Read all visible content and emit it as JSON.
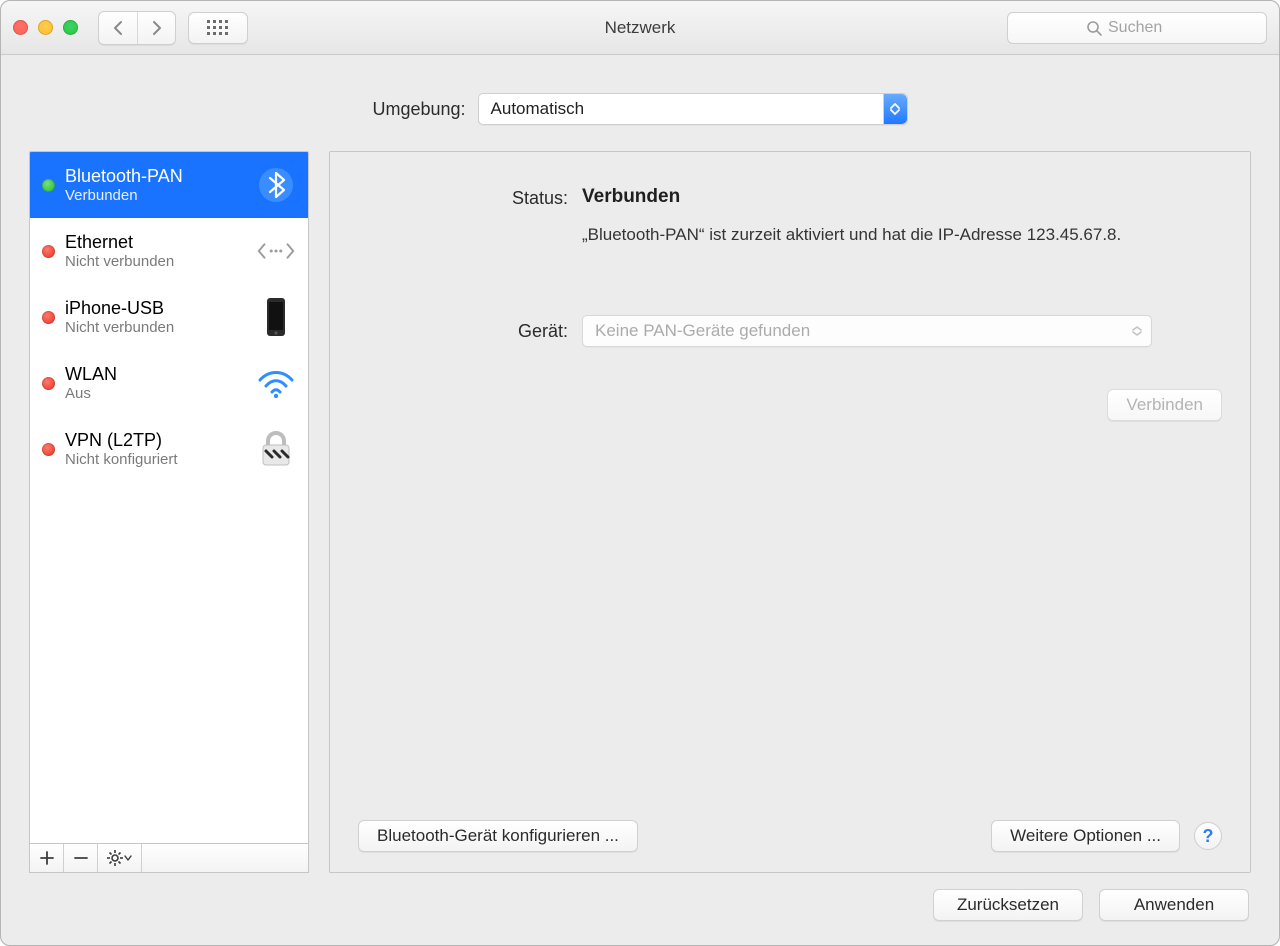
{
  "window": {
    "title": "Netzwerk"
  },
  "search": {
    "placeholder": "Suchen"
  },
  "environment": {
    "label": "Umgebung:",
    "value": "Automatisch"
  },
  "sidebar": {
    "items": [
      {
        "name": "Bluetooth-PAN",
        "status": "Verbunden",
        "dot": "green",
        "icon": "bluetooth",
        "selected": true
      },
      {
        "name": "Ethernet",
        "status": "Nicht verbunden",
        "dot": "red",
        "icon": "ethernet",
        "selected": false
      },
      {
        "name": "iPhone-USB",
        "status": "Nicht verbunden",
        "dot": "red",
        "icon": "phone",
        "selected": false
      },
      {
        "name": "WLAN",
        "status": "Aus",
        "dot": "red",
        "icon": "wifi",
        "selected": false
      },
      {
        "name": "VPN (L2TP)",
        "status": "Nicht konfiguriert",
        "dot": "red",
        "icon": "lock",
        "selected": false
      }
    ]
  },
  "detail": {
    "status_label": "Status:",
    "status_value": "Verbunden",
    "status_desc": "„Bluetooth-PAN“ ist zurzeit aktiviert und hat die IP-Adresse 123.45.67.8.",
    "device_label": "Gerät:",
    "device_value": "Keine PAN-Geräte gefunden",
    "connect_button": "Verbinden",
    "configure_button": "Bluetooth-Gerät konfigurieren ...",
    "advanced_button": "Weitere Optionen ..."
  },
  "footer": {
    "revert": "Zurücksetzen",
    "apply": "Anwenden"
  }
}
